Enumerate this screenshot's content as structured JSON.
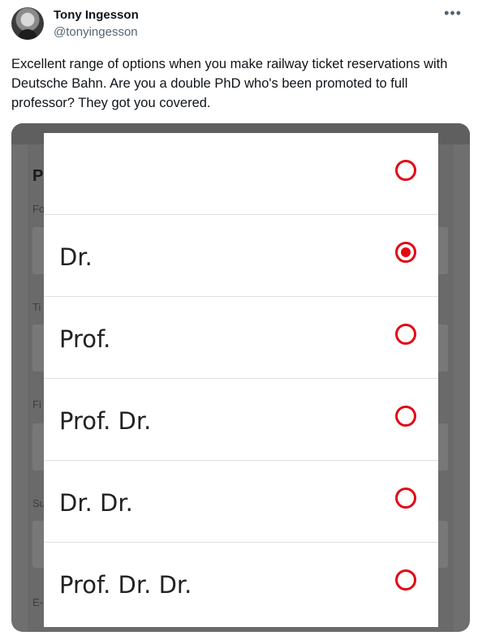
{
  "tweet": {
    "author_name": "Tony Ingesson",
    "author_handle": "@tonyingesson",
    "more_icon": "ellipsis-icon",
    "text": "Excellent range of options when you make railway ticket reservations with Deutsche Bahn. Are you a double PhD who's been promoted to full professor? They got you covered."
  },
  "background_form": {
    "title_fragment": "P",
    "field_label_fragments": [
      "Fo",
      "Ti",
      "Fi",
      "Su",
      "E-"
    ]
  },
  "dialog": {
    "accent_color": "#e30613",
    "options": [
      {
        "label": "",
        "selected": false
      },
      {
        "label": "Dr.",
        "selected": true
      },
      {
        "label": "Prof.",
        "selected": false
      },
      {
        "label": "Prof. Dr.",
        "selected": false
      },
      {
        "label": "Dr. Dr.",
        "selected": false
      },
      {
        "label": "Prof. Dr. Dr.",
        "selected": false
      }
    ]
  }
}
